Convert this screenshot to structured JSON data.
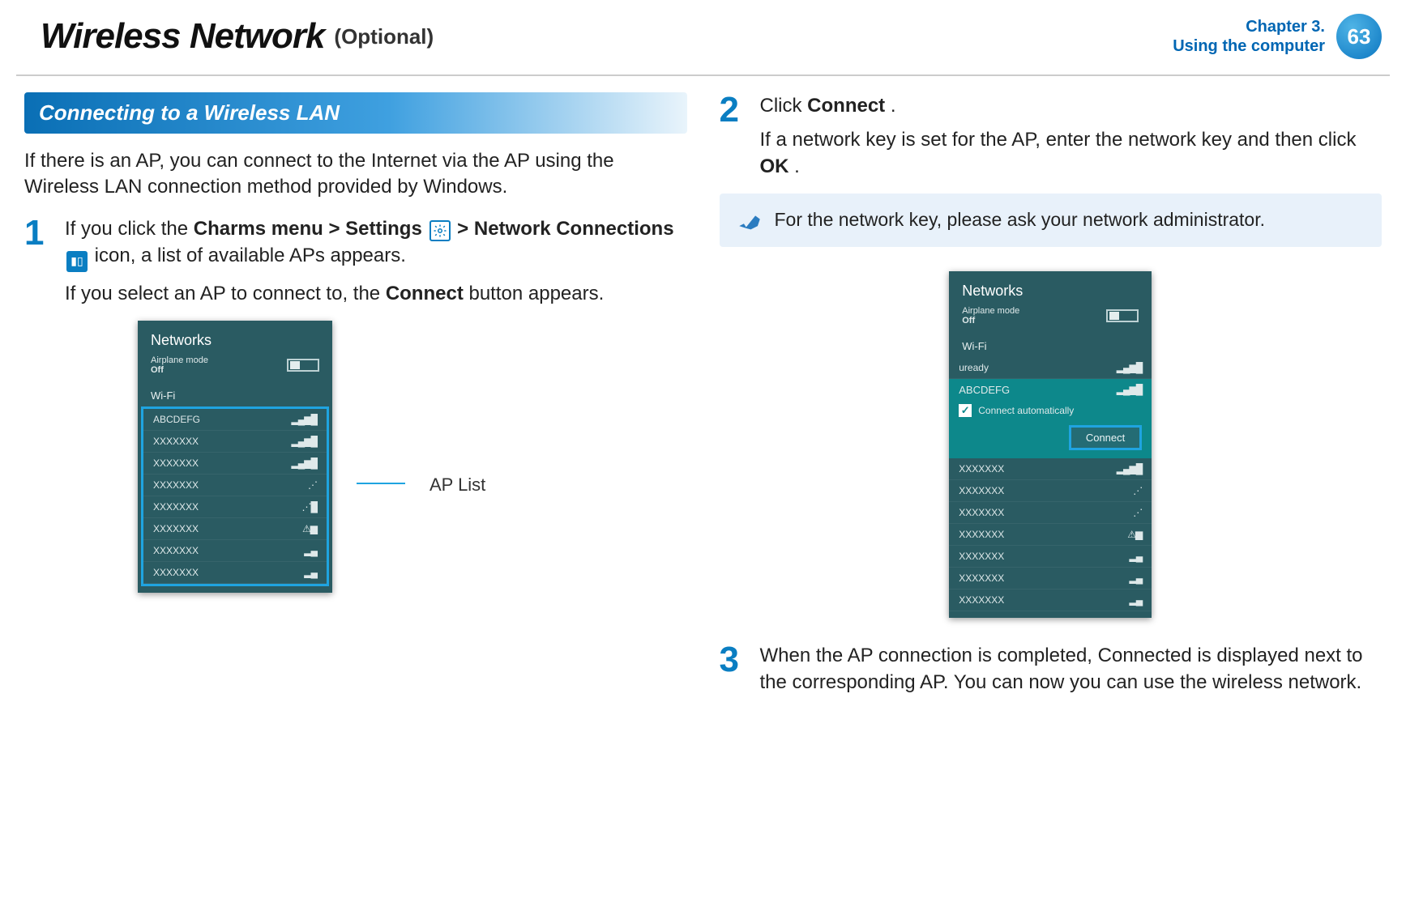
{
  "header": {
    "title": "Wireless Network",
    "subtitle": "(Optional)",
    "chapter_line1": "Chapter 3.",
    "chapter_line2": "Using the computer",
    "page_number": "63"
  },
  "section": {
    "heading": "Connecting to a Wireless LAN",
    "intro": "If there is an AP, you can connect to the Internet via the AP using the Wireless LAN connection method provided by Windows."
  },
  "steps": {
    "s1": {
      "num": "1",
      "part_a": "If you click the ",
      "charms": "Charms menu",
      "gt1": " > ",
      "settings": "Settings",
      "gt2": " > ",
      "netconn": "Network Connections",
      "part_b": " icon, a list of available APs appears.",
      "line2_a": "If you select an AP to connect to, the ",
      "connect": "Connect",
      "line2_b": " button appears."
    },
    "s2": {
      "num": "2",
      "line1_a": "Click ",
      "line1_b": "Connect",
      "line1_c": ".",
      "line2_a": "If a network key is set for the AP, enter the network key and then click ",
      "line2_b": "OK",
      "line2_c": "."
    },
    "s3": {
      "num": "3",
      "text": "When the AP connection is completed, Connected is displayed next to the corresponding AP. You can now you can use the wireless network."
    }
  },
  "note": "For the network key, please ask your network administrator.",
  "callout": {
    "ap_list": "AP List"
  },
  "panel1": {
    "title": "Networks",
    "airplane_label": "Airplane mode",
    "airplane_state": "Off",
    "wifi_label": "Wi-Fi",
    "aps": [
      {
        "name": "ABCDEFG",
        "sig": "▂▄▆█"
      },
      {
        "name": "XXXXXXX",
        "sig": "▂▄▆█"
      },
      {
        "name": "XXXXXXX",
        "sig": "▂▄▆█"
      },
      {
        "name": "XXXXXXX",
        "sig": "⋰"
      },
      {
        "name": "XXXXXXX",
        "sig": "⋰█"
      },
      {
        "name": "XXXXXXX",
        "sig": "⚠▆"
      },
      {
        "name": "XXXXXXX",
        "sig": "▂▄"
      },
      {
        "name": "XXXXXXX",
        "sig": "▂▄"
      }
    ]
  },
  "panel2": {
    "title": "Networks",
    "airplane_label": "Airplane mode",
    "airplane_state": "Off",
    "wifi_label": "Wi-Fi",
    "uready": "uready",
    "selected": "ABCDEFG",
    "connect_auto": "Connect automatically",
    "connect_btn": "Connect",
    "rest_aps": [
      {
        "name": "XXXXXXX",
        "sig": "▂▄▆█"
      },
      {
        "name": "XXXXXXX",
        "sig": "⋰"
      },
      {
        "name": "XXXXXXX",
        "sig": "⋰"
      },
      {
        "name": "XXXXXXX",
        "sig": "⚠▆"
      },
      {
        "name": "XXXXXXX",
        "sig": "▂▄"
      },
      {
        "name": "XXXXXXX",
        "sig": "▂▄"
      },
      {
        "name": "XXXXXXX",
        "sig": "▂▄"
      }
    ]
  }
}
